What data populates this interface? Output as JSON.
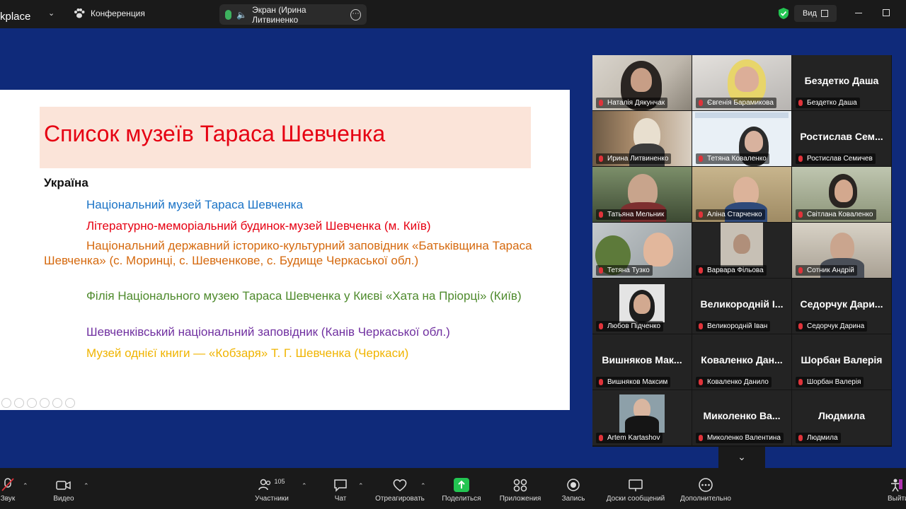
{
  "topbar": {
    "app_name": "kplace",
    "conference_label": "Конференция",
    "screen_share_label": "Экран (Ирина Литвиненко",
    "view_label": "Вид"
  },
  "slide": {
    "title": "Список музеїв Тараса Шевченка",
    "heading": "Україна",
    "museums": [
      "Національний музей Тараса Шевченка",
      "Літературно-меморіальний будинок-музей Шевченка (м. Київ)",
      "Національний державний історико-культурний заповідник «Батьківщина Тараса Шевченка» (с. Моринці, с. Шевченкове, с. Будище Черкаської обл.)",
      "Філія Національного музею Тараса Шевченка у Києві «Хата на Пріорці» (Київ)",
      "Шевченківський національний заповідник (Канів Черкаської обл.)",
      "Музей однієї книги — «Кобзаря» Т. Г. Шевченка (Черкаси)"
    ]
  },
  "gallery": {
    "participants": [
      {
        "name": "Наталія Дякунчак",
        "big": ""
      },
      {
        "name": "Євгенія Барамикова",
        "big": ""
      },
      {
        "name": "Бездетко Даша",
        "big": "Бездетко Даша"
      },
      {
        "name": "Ирина Литвиненко",
        "big": ""
      },
      {
        "name": "Тетяна Коваленко",
        "big": ""
      },
      {
        "name": "Ростислав Семичев",
        "big": "Ростислав Сем..."
      },
      {
        "name": "Татьяна Мельник",
        "big": ""
      },
      {
        "name": "Аліна Старченко",
        "big": ""
      },
      {
        "name": "Світлана Коваленко",
        "big": ""
      },
      {
        "name": "Тетяна Тузко",
        "big": ""
      },
      {
        "name": "Варвара Фільова",
        "big": ""
      },
      {
        "name": "Сотник Андрій",
        "big": ""
      },
      {
        "name": "Любов Підченко",
        "big": ""
      },
      {
        "name": "Великородній Іван",
        "big": "Великородній І..."
      },
      {
        "name": "Седорчук Дарина",
        "big": "Седорчук Дари..."
      },
      {
        "name": "Вишняков Максим",
        "big": "Вишняков Мак..."
      },
      {
        "name": "Коваленко Данило",
        "big": "Коваленко Дан..."
      },
      {
        "name": "Шорбан Валерія",
        "big": "Шорбан Валерія"
      },
      {
        "name": "Artem Kartashov",
        "big": ""
      },
      {
        "name": "Миколенко Валентина",
        "big": "Миколенко Ва..."
      },
      {
        "name": "Людмила",
        "big": "Людмила"
      }
    ]
  },
  "toolbar": {
    "audio": "Звук",
    "video": "Видео",
    "participants": "Участники",
    "participants_count": "105",
    "chat": "Чат",
    "react": "Отреагировать",
    "share": "Поделиться",
    "apps": "Приложения",
    "record": "Запись",
    "boards": "Доски сообщений",
    "more": "Дополнительно",
    "leave": "Выйти"
  },
  "colors": {
    "background_blue": "#0f2a7a",
    "title_red": "#e60012",
    "active_speaker": "#23d959",
    "share_green": "#23c552"
  }
}
